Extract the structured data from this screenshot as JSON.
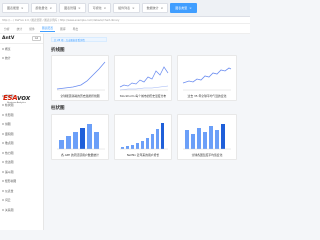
{
  "tabs": [
    {
      "label": "图表能量"
    },
    {
      "label": "颜色量化"
    },
    {
      "label": "图表管理"
    },
    {
      "label": "可视化"
    },
    {
      "label": "组件列表"
    },
    {
      "label": "数据统计"
    },
    {
      "label": "图表类型",
      "active": true
    }
  ],
  "urlbar": {
    "text": "http://... / DeFlux 2.0 / 图表管理 / 图表示例库 / http://www.example.com/dataviz/chart-library"
  },
  "toolbar": {
    "items": [
      "分析",
      "统计",
      "组件",
      "图表配置",
      "图库",
      "导出"
    ],
    "selected_index": 3
  },
  "sidebar": {
    "title": "AntV",
    "input_value": "G2",
    "items": [
      "概览",
      "统计",
      "",
      "",
      "",
      "",
      "折线图",
      "柱状图",
      "条形图",
      "饼图",
      "面积图",
      "散点图",
      "热力图",
      "雷达图",
      "漏斗图",
      "矩形树图",
      "仪表盘",
      "词云",
      "关系图"
    ]
  },
  "logo": {
    "brand_red": "ESA",
    "brand_dark": "vox",
    "sub": "Business Analytics"
  },
  "notice": {
    "text": "共 28 项 · 点击图表查看详情"
  },
  "sections": {
    "line": "折线图",
    "bar": "柱状图"
  },
  "cards_line": [
    {
      "caption": "全球能源消耗的历史趋势折线图"
    },
    {
      "caption": "Stockholm 每个城市的历史温度分布"
    },
    {
      "caption": "过去 35 年全球平均气温的变化"
    }
  ],
  "cards_bar": [
    {
      "caption": "各 APP 的周活跃用户数量统计"
    },
    {
      "caption": "Netflix 近年来的用户增长"
    },
    {
      "caption": "全球各国温度平均值变化"
    }
  ],
  "colors": {
    "accent": "#409eff",
    "bar_light": "#6b9ff8",
    "bar_dark": "#1f5fd9",
    "line": "#6a8cf0"
  }
}
